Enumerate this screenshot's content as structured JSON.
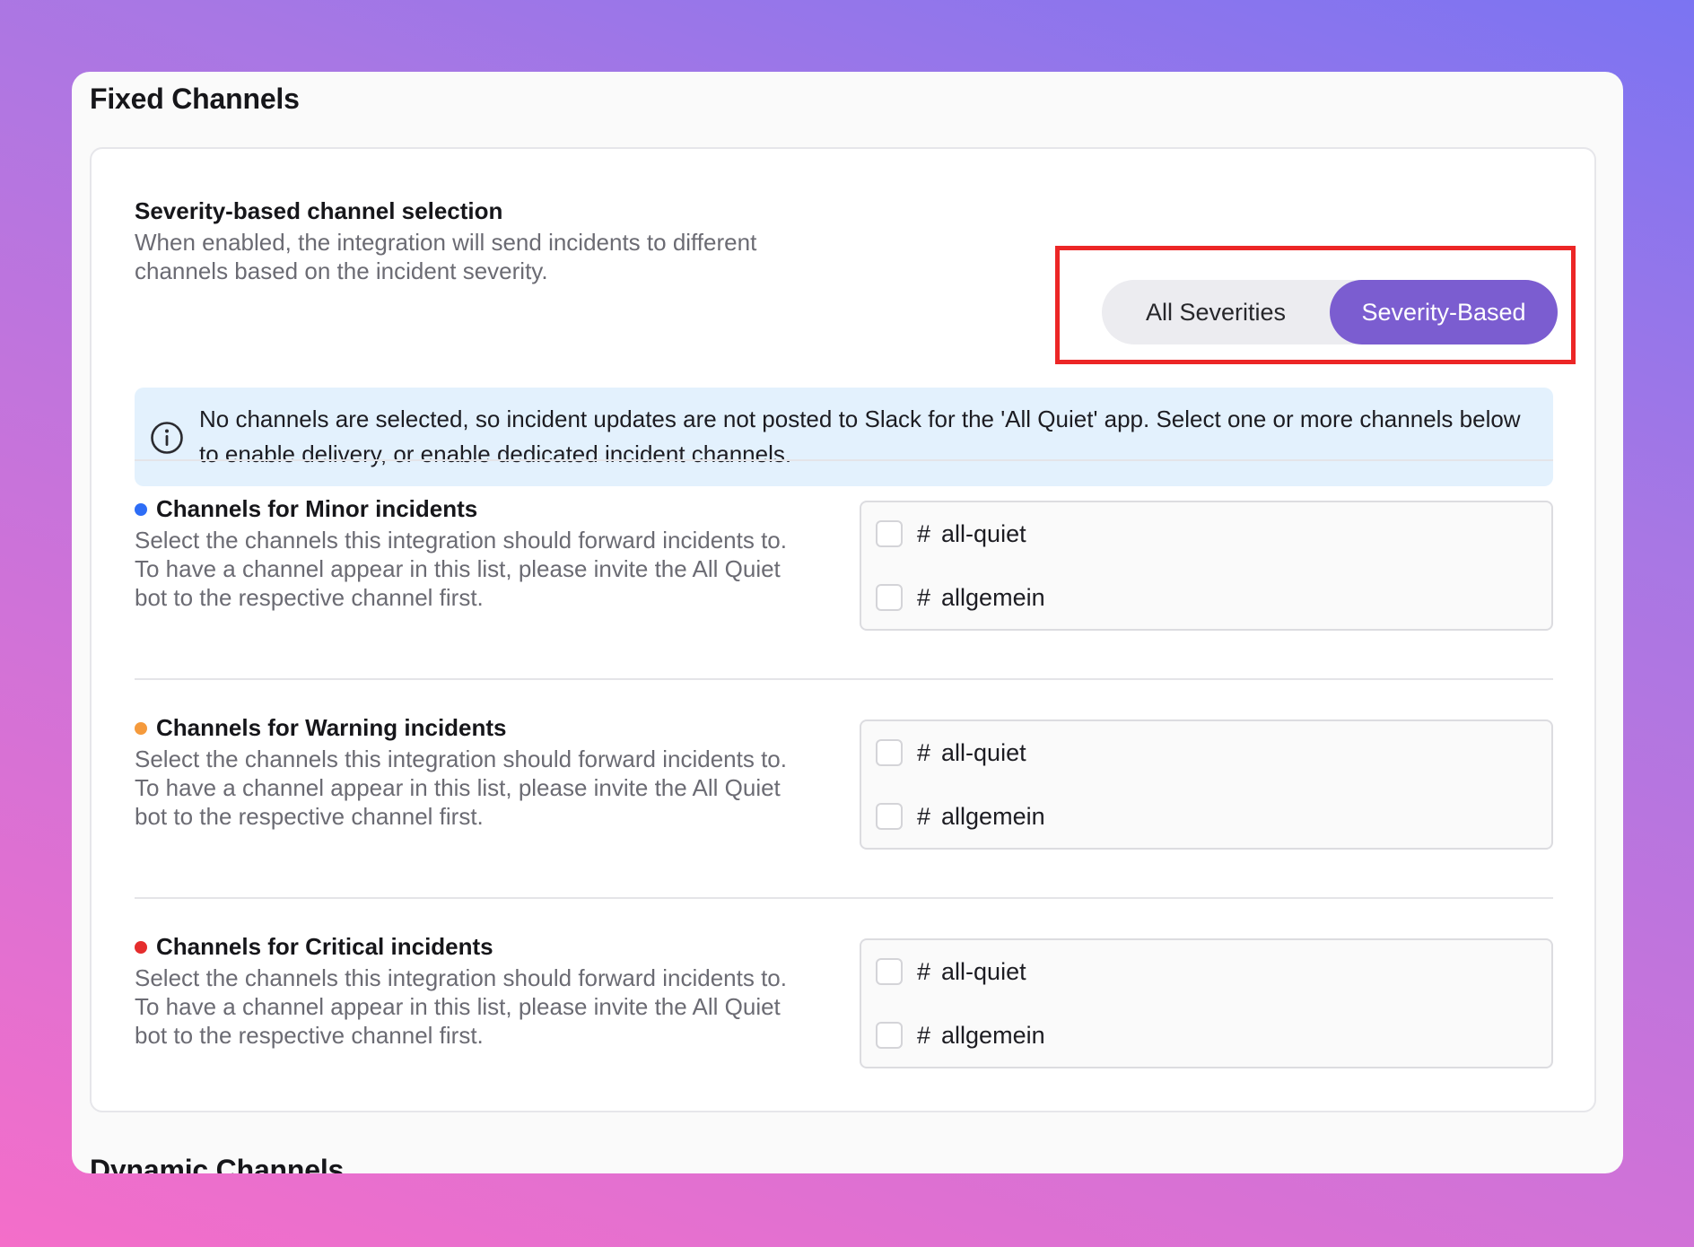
{
  "page": {
    "fixed_title": "Fixed Channels",
    "dynamic_title": "Dynamic Channels"
  },
  "severity_selection": {
    "title": "Severity-based channel selection",
    "description": "When enabled, the integration will send incidents to different channels based on the incident severity.",
    "options": [
      "All Severities",
      "Severity-Based"
    ],
    "selected": "Severity-Based"
  },
  "info_banner": {
    "icon": "info-icon",
    "text": "No channels are selected, so incident updates are not posted to Slack for the 'All Quiet' app. Select one or more channels below to enable delivery, or enable dedicated incident channels."
  },
  "severity_rows": [
    {
      "key": "minor",
      "title": "Channels for Minor incidents",
      "dot_color": "#2d6df6",
      "description": "Select the channels this integration should forward incidents to. To have a channel appear in this list, please invite the All Quiet bot to the respective channel first.",
      "channels": [
        {
          "hash": "#",
          "name": "all-quiet",
          "checked": false
        },
        {
          "hash": "#",
          "name": "allgemein",
          "checked": false
        }
      ]
    },
    {
      "key": "warning",
      "title": "Channels for Warning incidents",
      "dot_color": "#f59a3c",
      "description": "Select the channels this integration should forward incidents to. To have a channel appear in this list, please invite the All Quiet bot to the respective channel first.",
      "channels": [
        {
          "hash": "#",
          "name": "all-quiet",
          "checked": false
        },
        {
          "hash": "#",
          "name": "allgemein",
          "checked": false
        }
      ]
    },
    {
      "key": "critical",
      "title": "Channels for Critical incidents",
      "dot_color": "#e52d2d",
      "description": "Select the channels this integration should forward incidents to. To have a channel appear in this list, please invite the All Quiet bot to the respective channel first.",
      "channels": [
        {
          "hash": "#",
          "name": "all-quiet",
          "checked": false
        },
        {
          "hash": "#",
          "name": "allgemein",
          "checked": false
        }
      ]
    }
  ],
  "colors": {
    "accent": "#7b5dd0",
    "highlight": "#ec2626",
    "info_bg": "#e3f1fd"
  }
}
